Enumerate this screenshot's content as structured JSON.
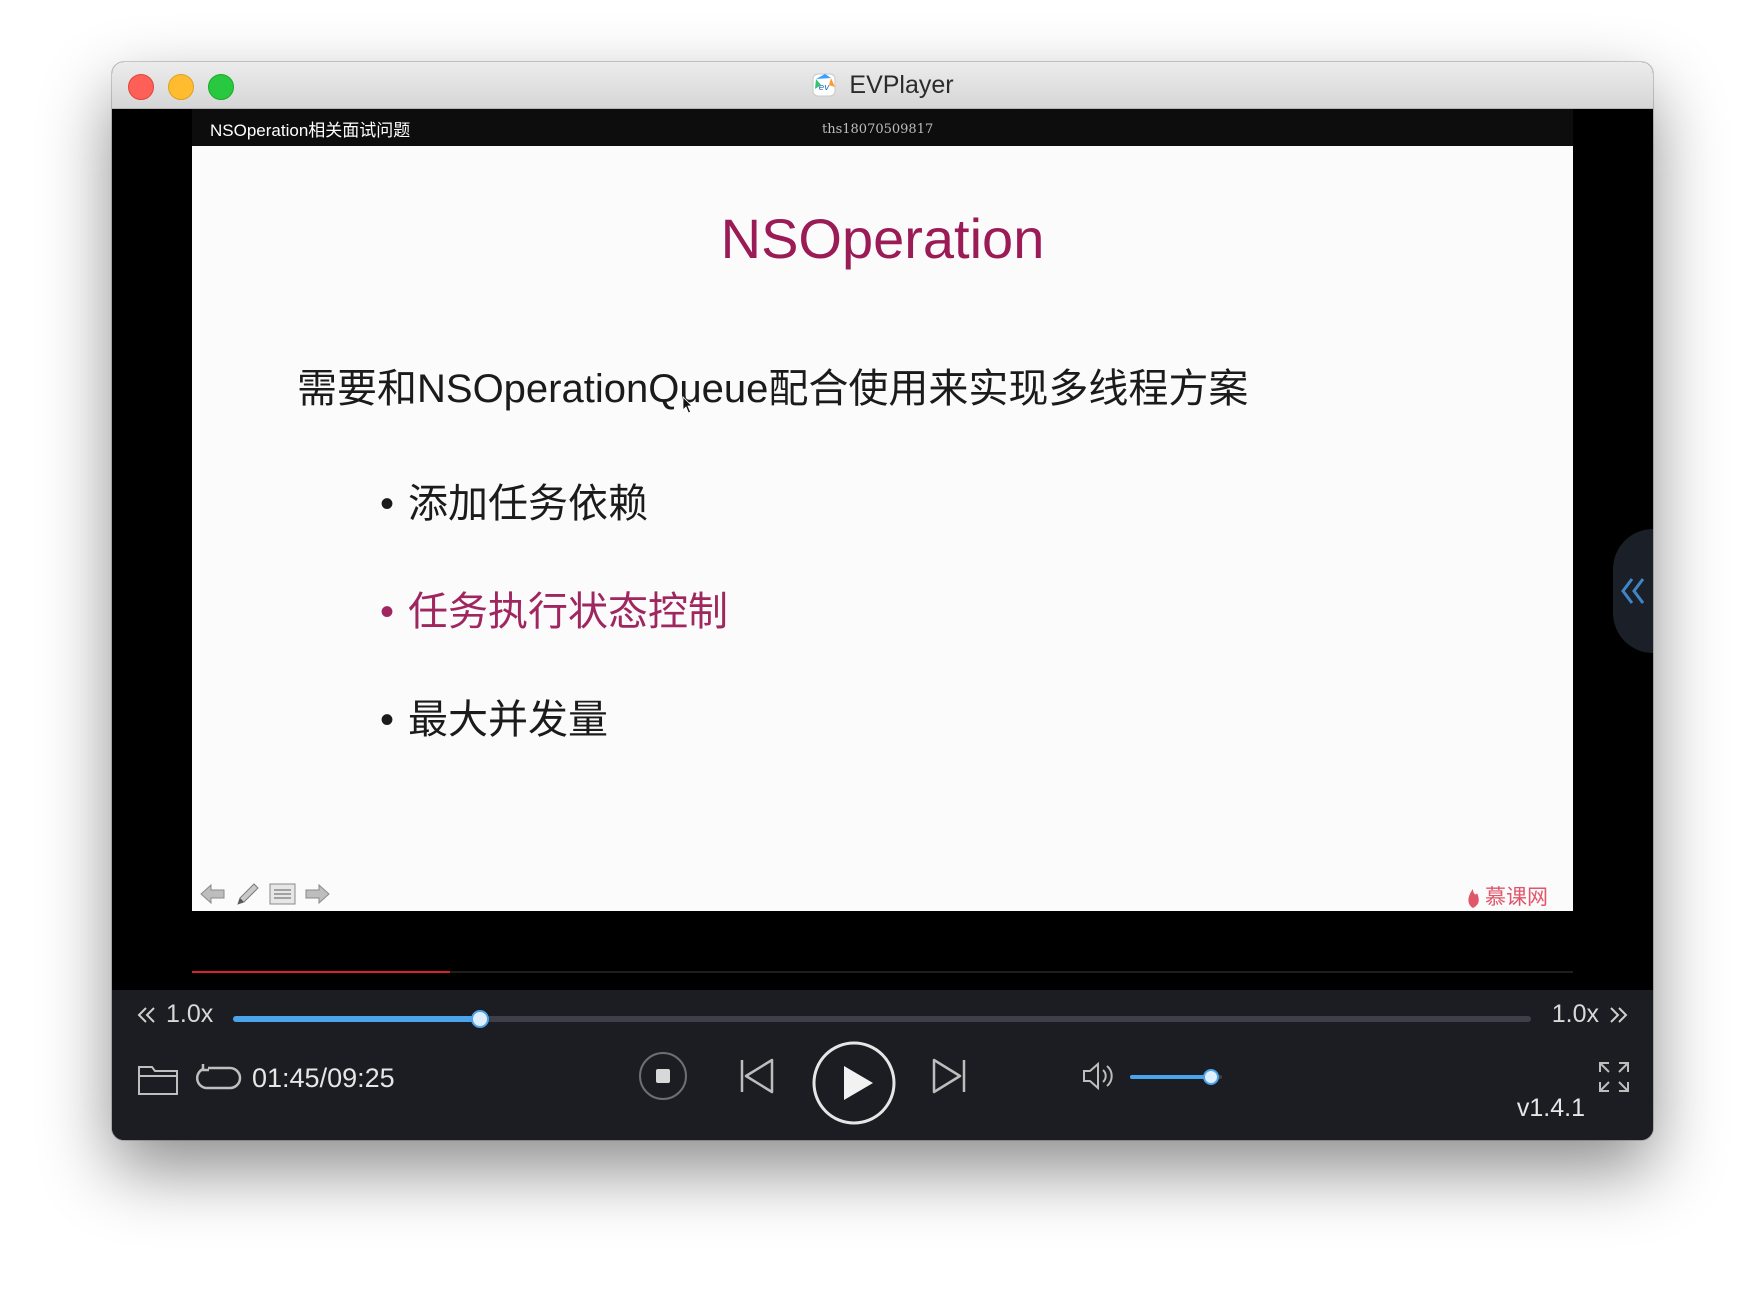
{
  "window": {
    "title": "EVPlayer",
    "app_icon": "evplayer-app-icon"
  },
  "video": {
    "lesson_title": "NSOperation相关面试问题",
    "watermark_text": "ths18070509817",
    "slide": {
      "title": "NSOperation",
      "subtitle": "需要和NSOperationQueue配合使用来实现多线程方案",
      "bullets": [
        {
          "text": "添加任务依赖",
          "highlighted": false
        },
        {
          "text": "任务执行状态控制",
          "highlighted": true
        },
        {
          "text": "最大并发量",
          "highlighted": false
        }
      ],
      "bullet_glyph": "•",
      "tools": [
        "arrow-left-icon",
        "pen-icon",
        "list-icon",
        "arrow-right-icon"
      ],
      "brand_logo_text": "慕课网",
      "title_color": "#9b1b56",
      "highlight_color": "#a0265f"
    },
    "slide_progress": 0.187
  },
  "controls": {
    "speed_left": "1.0x",
    "speed_right": "1.0x",
    "seek_progress": 0.19,
    "time_display": "01:45/09:25",
    "volume_level": 0.88,
    "version": "v1.4.1",
    "accent_color": "#4ba3ea",
    "icons": {
      "folder": "folder-icon",
      "loop": "loop-icon",
      "stop": "stop-icon",
      "prev": "skip-previous-icon",
      "play": "play-icon",
      "next": "skip-next-icon",
      "volume": "volume-icon",
      "fullscreen": "fullscreen-icon",
      "side_panel": "double-chevron-left-icon"
    }
  }
}
